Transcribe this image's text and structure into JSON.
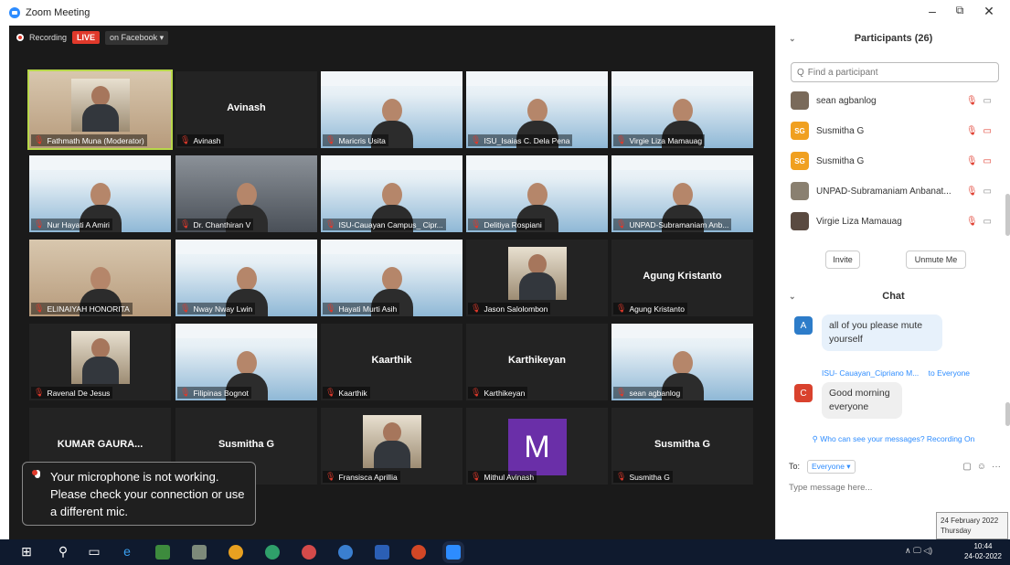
{
  "window": {
    "title": "Zoom Meeting",
    "minimize": "–",
    "maximize": "⧉",
    "close": "✕"
  },
  "recording": {
    "label": "Recording",
    "live": "LIVE",
    "platform": "on Facebook ▾"
  },
  "tiles": [
    {
      "name": "Fathmath Muna (Moderator)",
      "style": "photo-warm",
      "kind": "thumb",
      "active": true
    },
    {
      "name": "Avinash",
      "style": "dark",
      "kind": "name",
      "center": "Avinash"
    },
    {
      "name": "Maricris Usita",
      "style": "banner",
      "kind": "person"
    },
    {
      "name": "ISU_Isaias C. Dela Pena",
      "style": "banner",
      "kind": "person"
    },
    {
      "name": "Virgie Liza Mamauag",
      "style": "banner",
      "kind": "person"
    },
    {
      "name": "Nur Hayati A Amiri",
      "style": "banner",
      "kind": "person"
    },
    {
      "name": "Dr. Chanthiran V",
      "style": "photo-gray",
      "kind": "person"
    },
    {
      "name": "ISU-Cauayan Campus_ Cipr...",
      "style": "banner",
      "kind": "person"
    },
    {
      "name": "Delitiya Rospiani",
      "style": "banner",
      "kind": "person"
    },
    {
      "name": "UNPAD-Subramaniam Anb...",
      "style": "banner",
      "kind": "person"
    },
    {
      "name": "ELINAIYAH HONORITA",
      "style": "photo-warm",
      "kind": "person"
    },
    {
      "name": "Nway Nway Lwin",
      "style": "banner",
      "kind": "person"
    },
    {
      "name": "Hayati Murti Asih",
      "style": "banner",
      "kind": "person"
    },
    {
      "name": "Jason Salolombon",
      "style": "dark",
      "kind": "thumb"
    },
    {
      "name": "Agung Kristanto",
      "style": "dark",
      "kind": "name",
      "center": "Agung Kristanto"
    },
    {
      "name": "Ravenal De Jesus",
      "style": "dark",
      "kind": "thumb"
    },
    {
      "name": "Filipinas Bognot",
      "style": "banner",
      "kind": "person"
    },
    {
      "name": "Kaarthik",
      "style": "dark",
      "kind": "name",
      "center": "Kaarthik"
    },
    {
      "name": "Karthikeyan",
      "style": "dark",
      "kind": "name",
      "center": "Karthikeyan"
    },
    {
      "name": "sean agbanlog",
      "style": "banner",
      "kind": "person"
    },
    {
      "name": "",
      "style": "dark",
      "kind": "name",
      "center": "KUMAR GAURA..."
    },
    {
      "name": "",
      "style": "dark",
      "kind": "name",
      "center": "Susmitha G"
    },
    {
      "name": "Fransisca Aprillia",
      "style": "dark",
      "kind": "thumb"
    },
    {
      "name": "Mithul Avinash",
      "style": "dark",
      "kind": "avatar",
      "letter": "M"
    },
    {
      "name": "Susmitha G",
      "style": "dark",
      "kind": "name",
      "center": "Susmitha G"
    }
  ],
  "toast": {
    "message": "Your microphone is not working. Please check your connection or use a different mic."
  },
  "participants": {
    "title": "Participants (26)",
    "search_placeholder": "Find a participant",
    "items": [
      {
        "name": "sean agbanlog",
        "initials": "",
        "color": "#7a6a5a",
        "cam_off": false
      },
      {
        "name": "Susmitha G",
        "initials": "SG",
        "color": "#f0a020",
        "cam_off": true
      },
      {
        "name": "Susmitha G",
        "initials": "SG",
        "color": "#f0a020",
        "cam_off": true
      },
      {
        "name": "UNPAD-Subramaniam Anbanat...",
        "initials": "",
        "color": "#8a8070",
        "cam_off": false
      },
      {
        "name": "Virgie Liza Mamauag",
        "initials": "",
        "color": "#5a4a40",
        "cam_off": false
      }
    ],
    "invite": "Invite",
    "unmute": "Unmute Me"
  },
  "chat": {
    "title": "Chat",
    "messages": [
      {
        "avatar": "A",
        "color": "#2d7cc9",
        "text": "all of you please mute yourself"
      },
      {
        "avatar": "C",
        "color": "#d9422e",
        "text": "Good morning everyone"
      }
    ],
    "sender_line": "ISU- Cauayan_Cipriano M...",
    "sender_to": "to Everyone",
    "privacy": "Who can see your messages? Recording On",
    "to_label": "To:",
    "to_value": "Everyone ▾",
    "input_placeholder": "Type message here..."
  },
  "taskbar": {
    "time": "10:44",
    "date": "24-02-2022",
    "tooltip_date": "24 February 2022",
    "tooltip_day": "Thursday",
    "tray": "∧ 🖵 ◁)"
  }
}
